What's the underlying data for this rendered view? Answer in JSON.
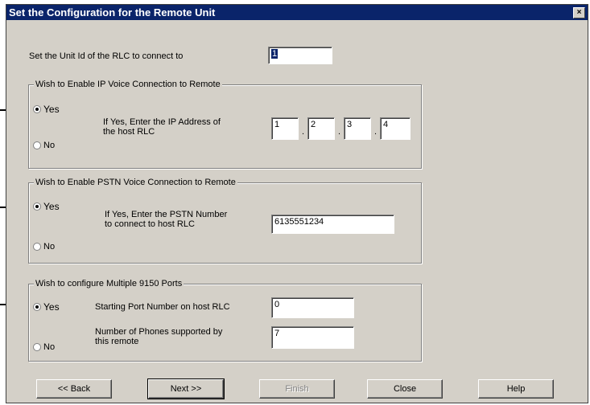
{
  "window": {
    "title": "Set the Configuration for the Remote Unit",
    "close_glyph": "×"
  },
  "unit_id": {
    "label": "Set the Unit Id of the RLC to connect to",
    "value": "1"
  },
  "ip_group": {
    "legend": "Wish to Enable IP Voice Connection to Remote",
    "yes_label": "Yes",
    "no_label": "No",
    "selected": "Yes",
    "prompt_line1": "If Yes, Enter the IP Address of",
    "prompt_line2": "the host RLC",
    "octets": [
      "1",
      "2",
      "3",
      "4"
    ],
    "separator": "."
  },
  "pstn_group": {
    "legend": "Wish to Enable PSTN Voice Connection to Remote",
    "yes_label": "Yes",
    "no_label": "No",
    "selected": "Yes",
    "prompt_line1": "If Yes, Enter the PSTN Number",
    "prompt_line2": "to connect to host RLC",
    "number": "6135551234"
  },
  "ports_group": {
    "legend": "Wish to configure Multiple 9150 Ports",
    "yes_label": "Yes",
    "no_label": "No",
    "selected": "Yes",
    "start_label": "Starting Port Number on host RLC",
    "start_value": "0",
    "phones_label_line1": "Number of Phones supported by",
    "phones_label_line2": "this remote",
    "phones_value": "7"
  },
  "buttons": {
    "back": "<<   Back",
    "next": "Next   >>",
    "finish": "Finish",
    "close": "Close",
    "help": "Help"
  }
}
